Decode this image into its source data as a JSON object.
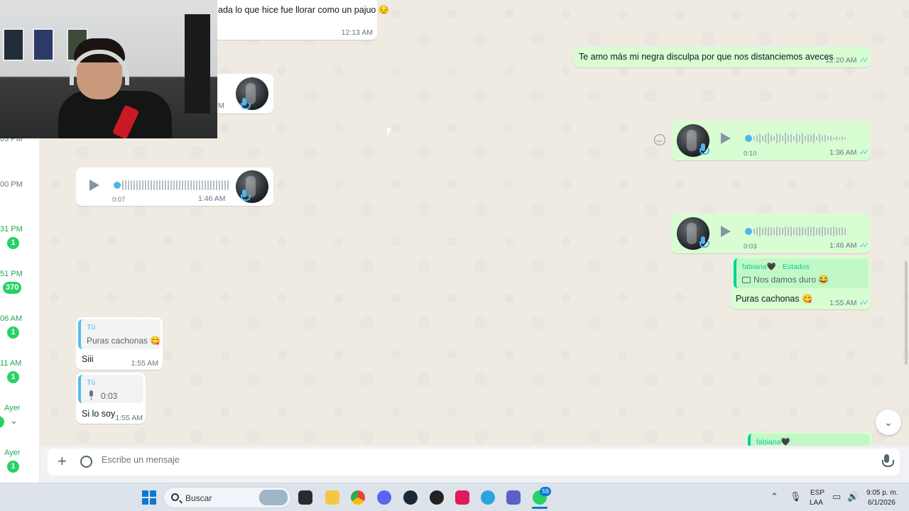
{
  "left_list": {
    "items": [
      {
        "time": "03 PM",
        "badge": ""
      },
      {
        "time": "00 PM",
        "badge": ""
      },
      {
        "time": "31 PM",
        "badge": "1"
      },
      {
        "time": "51 PM",
        "badge": "370"
      },
      {
        "time": "06 AM",
        "badge": "1"
      },
      {
        "time": "11 AM",
        "badge": "1"
      },
      {
        "time": "Ayer",
        "badge": ""
      },
      {
        "time": "Ayer",
        "badge": "1"
      }
    ]
  },
  "messages": {
    "m1": {
      "text": "ada lo que hice fue llorar como un pajuo 😔",
      "time": "12:13 AM"
    },
    "m2": {
      "text": "Te amo más mi negra disculpa por que nos distanciemos aveces",
      "time": "12:20 AM"
    },
    "m3": {
      "partial_time": "M"
    },
    "m4": {
      "duration": "0:10",
      "time": "1:36 AM"
    },
    "m5": {
      "duration": "0:07",
      "time": "1:46 AM"
    },
    "m6": {
      "duration": "0:03",
      "time": "1:46 AM"
    },
    "m7": {
      "quote_author": "fabiana🖤 · Estados",
      "quote_text": "Nos damos duro 😂",
      "text": "Puras cachonas 😋",
      "time": "1:55 AM"
    },
    "m8": {
      "quote_author": "Tú",
      "quote_text": "Puras cachonas 😋",
      "text": "Siii",
      "time": "1:55 AM"
    },
    "m9": {
      "quote_author": "Tú",
      "quote_text": "0:03",
      "text": "Si lo soy",
      "time": "1:55 AM"
    },
    "m10": {
      "quote_author": "fabiana🖤"
    }
  },
  "composer": {
    "placeholder": "Escribe un mensaje"
  },
  "taskbar": {
    "search_label": "Buscar",
    "whatsapp_badge": "59",
    "lang_top": "ESP",
    "lang_bottom": "LAA",
    "time": "9:05 p. m.",
    "date": "6/1/2026"
  },
  "colors": {
    "chat_bg": "#efeae2",
    "outgoing_bubble": "#d9fdd3",
    "incoming_bubble": "#ffffff",
    "badge_green": "#25d366",
    "read_ticks": "#53bdeb"
  }
}
